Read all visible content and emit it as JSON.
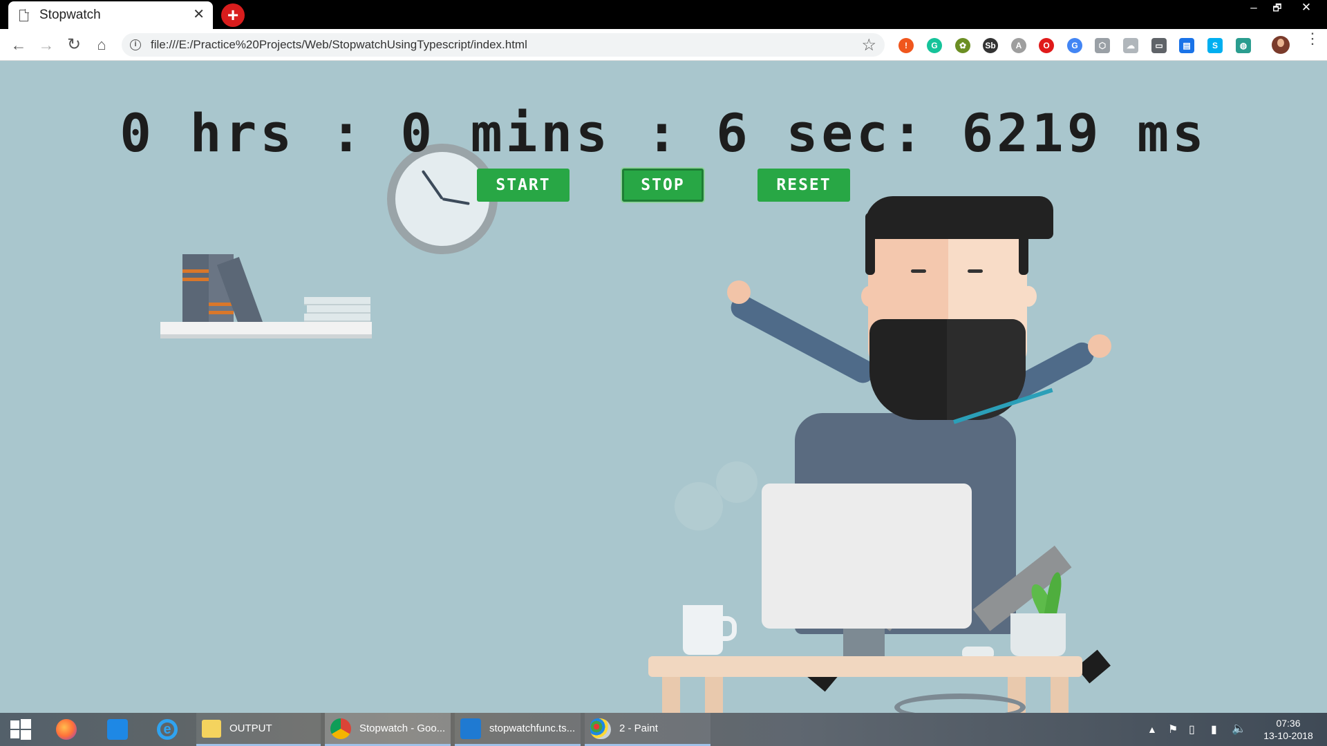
{
  "browser": {
    "tab_title": "Stopwatch",
    "tab_close": "✕",
    "new_tab": "+",
    "window_controls": [
      "–",
      "🗗",
      "✕"
    ],
    "url": "file:///E:/Practice%20Projects/Web/StopwatchUsingTypescript/index.html",
    "extensions": [
      {
        "name": "alert-extension-icon",
        "glyph": "!",
        "color": "#f0561d"
      },
      {
        "name": "grammarly-icon",
        "glyph": "G",
        "color": "#15c39a"
      },
      {
        "name": "bug-extension-icon",
        "glyph": "✿",
        "color": "#6b8e23"
      },
      {
        "name": "sb-extension-icon",
        "glyph": "Sb",
        "color": "#333333"
      },
      {
        "name": "translate-extension-icon",
        "glyph": "A",
        "color": "#9e9e9e"
      },
      {
        "name": "opera-extension-icon",
        "glyph": "O",
        "color": "#e01a1a"
      },
      {
        "name": "google-translate-icon",
        "glyph": "G",
        "color": "#4285f4"
      },
      {
        "name": "cube-extension-icon",
        "glyph": "⬡",
        "color": "#9aa0a6"
      },
      {
        "name": "cloud-extension-icon",
        "glyph": "☁",
        "color": "#b0b6bb"
      },
      {
        "name": "cast-extension-icon",
        "glyph": "▭",
        "color": "#5f6368"
      },
      {
        "name": "inbox-extension-icon",
        "glyph": "▤",
        "color": "#1a73e8"
      },
      {
        "name": "skype-extension-icon",
        "glyph": "S",
        "color": "#00aff0"
      },
      {
        "name": "globe-extension-icon",
        "glyph": "◍",
        "color": "#2a9d8f"
      }
    ]
  },
  "stopwatch": {
    "display": "0 hrs : 0 mins : 6 sec: 6219 ms",
    "hours": 0,
    "minutes": 0,
    "seconds": 6,
    "milliseconds": 6219,
    "buttons": {
      "start": "START",
      "stop": "STOP",
      "reset": "RESET"
    },
    "accent": "#28a745",
    "background": "#a9c6cd"
  },
  "taskbar": {
    "apps": [
      {
        "name": "output-folder",
        "label": "OUTPUT"
      },
      {
        "name": "chrome-stopwatch",
        "label": "Stopwatch - Goo..."
      },
      {
        "name": "vscode-stopwatch",
        "label": "stopwatchfunc.ts..."
      },
      {
        "name": "paint",
        "label": "2 - Paint"
      }
    ],
    "time": "07:36",
    "date": "13-10-2018"
  }
}
